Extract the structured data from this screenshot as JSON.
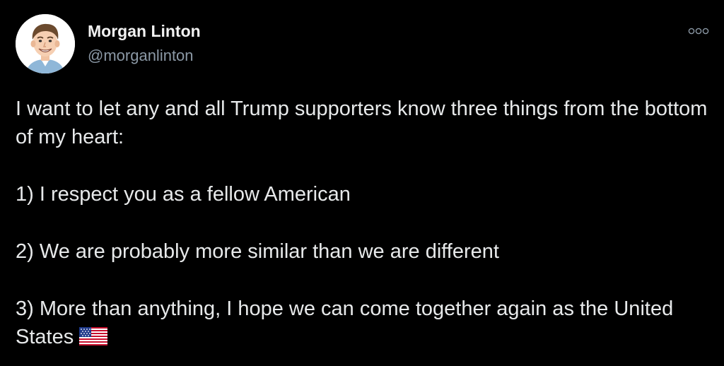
{
  "author": {
    "name": "Morgan Linton",
    "handle": "@morganlinton"
  },
  "icons": {
    "avatar": "cartoon-portrait-avatar",
    "more": "more-options-icon",
    "flag": "us-flag-emoji"
  },
  "tweet": {
    "paragraphs": [
      "I want to let any and all Trump supporters know three things from the bottom of my heart:",
      "1) I respect you as a fellow American",
      "2) We are probably more similar than we are different",
      "3) More than anything, I hope we can come together again as the United States"
    ]
  },
  "colors": {
    "background": "#000000",
    "text": "#e7e9ea",
    "secondary_text": "#8b98a5"
  }
}
